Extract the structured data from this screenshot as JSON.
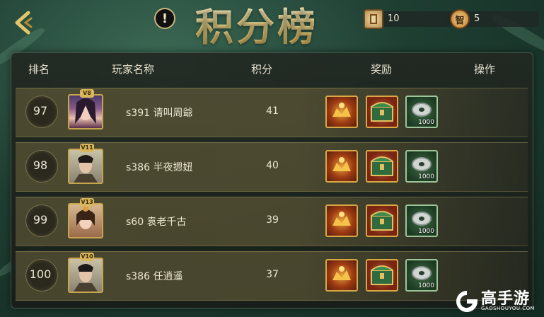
{
  "header": {
    "title": "积分榜",
    "alert_glyph": "!",
    "resources": [
      {
        "icon": "scroll-token-icon",
        "value": "10"
      },
      {
        "icon": "zhi-coin-icon",
        "glyph": "智",
        "value": "5"
      }
    ]
  },
  "table": {
    "columns": [
      "排名",
      "玩家名称",
      "积分",
      "奖励",
      "操作"
    ],
    "rows": [
      {
        "rank": "97",
        "vip": "V8",
        "name": "s391 请叫周爺",
        "score": "41",
        "rewards": [
          "fire-crown-icon",
          "green-chest-icon",
          "silver-coin-icon"
        ],
        "coin_qty": "1000",
        "avatar": "female-warrior"
      },
      {
        "rank": "98",
        "vip": "V11",
        "name": "s386 半夜摁妞",
        "score": "40",
        "rewards": [
          "fire-crown-icon",
          "green-chest-icon",
          "silver-coin-icon"
        ],
        "coin_qty": "1000",
        "avatar": "male-general"
      },
      {
        "rank": "99",
        "vip": "V13",
        "name": "s60 袁老千古",
        "score": "39",
        "rewards": [
          "fire-crown-icon",
          "green-chest-icon",
          "silver-coin-icon"
        ],
        "coin_qty": "1000",
        "avatar": "female-noble"
      },
      {
        "rank": "100",
        "vip": "V10",
        "name": "s386 任逍遥",
        "score": "37",
        "rewards": [
          "fire-crown-icon",
          "green-chest-icon",
          "silver-coin-icon"
        ],
        "coin_qty": "1000",
        "avatar": "male-general"
      }
    ]
  },
  "watermark": {
    "brand": "高手游",
    "domain": "GAOSHOUYOU.COM"
  },
  "colors": {
    "gold": "#d9a944",
    "panel": "#1e241f",
    "accent_green": "#2f5a45"
  }
}
